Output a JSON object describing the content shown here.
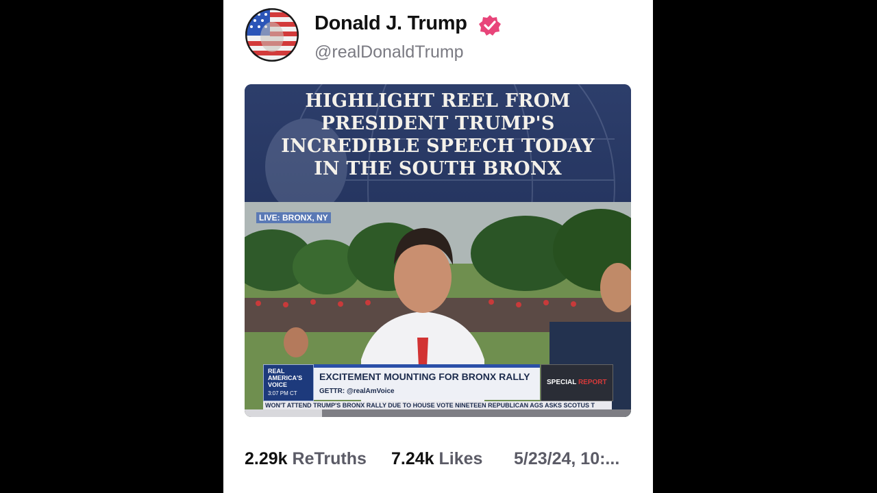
{
  "post": {
    "author": {
      "display_name": "Donald J. Trump",
      "handle": "@realDonaldTrump",
      "verified": true,
      "verified_badge_color": "#e8457a"
    },
    "media": {
      "type": "video",
      "headline_lines": [
        "HIGHLIGHT REEL FROM",
        "PRESIDENT TRUMP'S",
        "INCREDIBLE SPEECH TODAY",
        "IN THE SOUTH BRONX"
      ],
      "live_label": "LIVE: BRONX, NY",
      "chyron": {
        "logo_text": "REAL AMERICA'S VOICE",
        "time": "3:07 PM CT",
        "headline": "EXCITEMENT MOUNTING FOR BRONX RALLY",
        "sub": "GETTR: @realAmVoice",
        "special_label_part1": "SPECIAL",
        "special_label_part2": "REPORT",
        "ticker": "WON'T ATTEND TRUMP'S BRONX RALLY DUE TO HOUSE VOTE      NINETEEN REPUBLICAN AGS ASKS SCOTUS T"
      },
      "progress_fraction": 0.2
    },
    "stats": {
      "retruths_count": "2.29k",
      "retruths_label": "ReTruths",
      "likes_count": "7.24k",
      "likes_label": "Likes",
      "timestamp": "5/23/24, 10:..."
    }
  }
}
